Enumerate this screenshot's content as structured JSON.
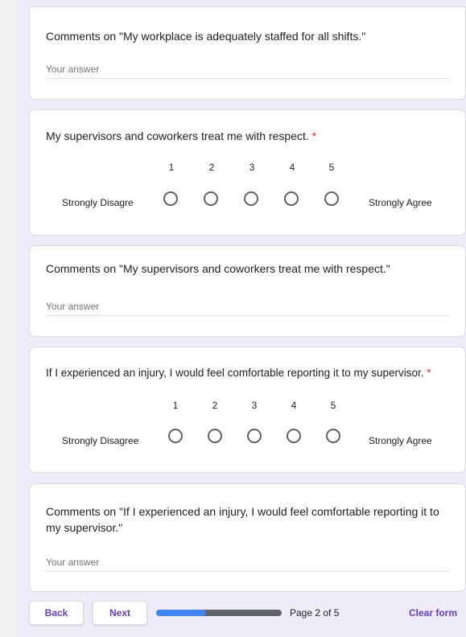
{
  "cards": [
    {
      "question": "Comments on \"My workplace is adequately staffed for all shifts.\"",
      "placeholder": "Your answer"
    },
    {
      "question": "My supervisors and coworkers treat me with respect.",
      "required": "*",
      "scale": [
        "1",
        "2",
        "3",
        "4",
        "5"
      ],
      "low_label": "Strongly Disagre",
      "high_label": "Strongly Agree"
    },
    {
      "question": "Comments on \"My supervisors and coworkers treat me with respect.\"",
      "placeholder": "Your answer"
    },
    {
      "question": "If I experienced an injury, I would feel comfortable reporting it to my supervisor.",
      "required": "*",
      "scale": [
        "1",
        "2",
        "3",
        "4",
        "5"
      ],
      "low_label": "Strongly Disagree",
      "high_label": "Strongly Agree"
    },
    {
      "question": "Comments on \"If I experienced an injury, I would feel comfortable reporting it to my supervisor.\"",
      "placeholder": "Your answer"
    }
  ],
  "footer": {
    "back_label": "Back",
    "next_label": "Next",
    "page_text": "Page 2 of 5",
    "progress_fraction": 0.4,
    "clear_label": "Clear form"
  },
  "colors": {
    "accent": "#673ab7",
    "progress": "#4285f4",
    "required": "#d93025"
  }
}
